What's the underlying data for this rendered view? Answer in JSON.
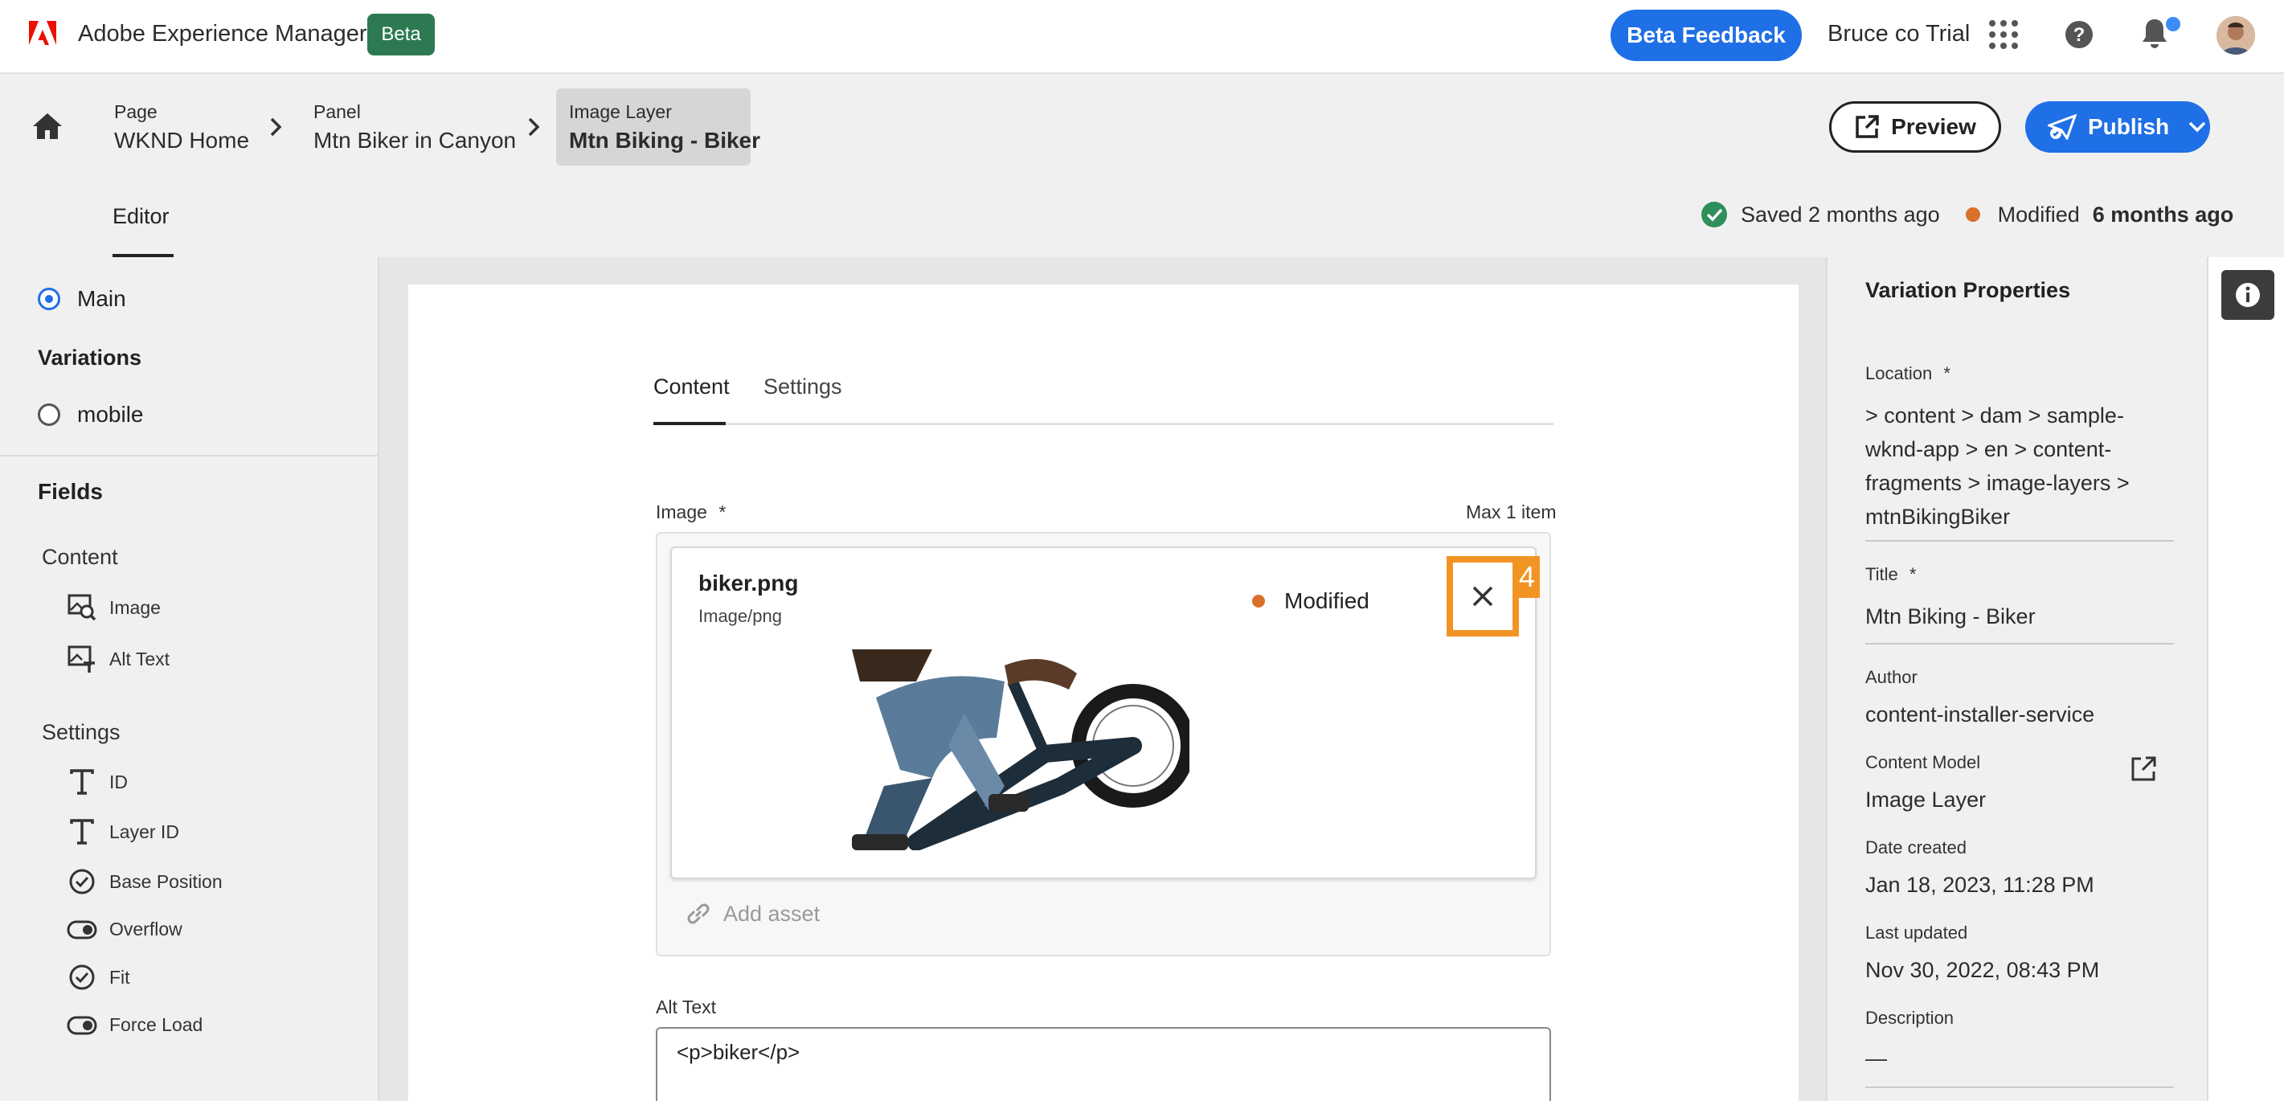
{
  "app": {
    "title": "Adobe Experience Manager",
    "beta_badge": "Beta",
    "beta_feedback": "Beta Feedback",
    "org_name": "Bruce co Trial"
  },
  "breadcrumbs": [
    {
      "type": "Page",
      "name": "WKND Home"
    },
    {
      "type": "Panel",
      "name": "Mtn Biker in Canyon"
    },
    {
      "type": "Image Layer",
      "name": "Mtn Biking - Biker"
    }
  ],
  "actions": {
    "preview": "Preview",
    "publish": "Publish"
  },
  "editor_tab": "Editor",
  "status": {
    "saved": "Saved 2 months ago",
    "modified_label": "Modified",
    "modified_time": "6 months ago"
  },
  "left_panel": {
    "main": "Main",
    "variations_heading": "Variations",
    "variation_mobile": "mobile",
    "fields_heading": "Fields",
    "content_group": "Content",
    "content_items": [
      {
        "label": "Image",
        "icon": "image-search-icon"
      },
      {
        "label": "Alt Text",
        "icon": "image-text-icon"
      }
    ],
    "settings_group": "Settings",
    "settings_items": [
      {
        "label": "ID",
        "icon": "text-icon"
      },
      {
        "label": "Layer ID",
        "icon": "text-icon"
      },
      {
        "label": "Base Position",
        "icon": "check-circle-icon"
      },
      {
        "label": "Overflow",
        "icon": "toggle-icon"
      },
      {
        "label": "Fit",
        "icon": "check-circle-icon"
      },
      {
        "label": "Force Load",
        "icon": "toggle-icon"
      }
    ]
  },
  "form": {
    "tabs": [
      "Content",
      "Settings"
    ],
    "image_label": "Image",
    "image_required": "*",
    "max_items": "Max 1 item",
    "asset": {
      "name": "biker.png",
      "type": "Image/png",
      "status": "Modified"
    },
    "step_number": "4",
    "add_asset": "Add asset",
    "alt_text_label": "Alt Text",
    "alt_text_value": "<p>biker</p>"
  },
  "right_panel": {
    "title": "Variation Properties",
    "location_label": "Location",
    "location_value": "> content > dam > sample-wknd-app > en > content-fragments > image-layers > mtnBikingBiker",
    "title_label": "Title",
    "title_value": "Mtn Biking - Biker",
    "author_label": "Author",
    "author_value": "content-installer-service",
    "model_label": "Content Model",
    "model_value": "Image Layer",
    "created_label": "Date created",
    "created_value": "Jan 18, 2023, 11:28 PM",
    "updated_label": "Last updated",
    "updated_value": "Nov 30, 2022, 08:43 PM",
    "description_label": "Description",
    "description_value": "—",
    "required_mark": "*"
  },
  "colors": {
    "accent_blue": "#1f6fe6",
    "beta_green": "#2d7a52",
    "modified_orange": "#d9702b",
    "highlight_orange": "#f29423",
    "saved_green": "#2d8f5a"
  }
}
